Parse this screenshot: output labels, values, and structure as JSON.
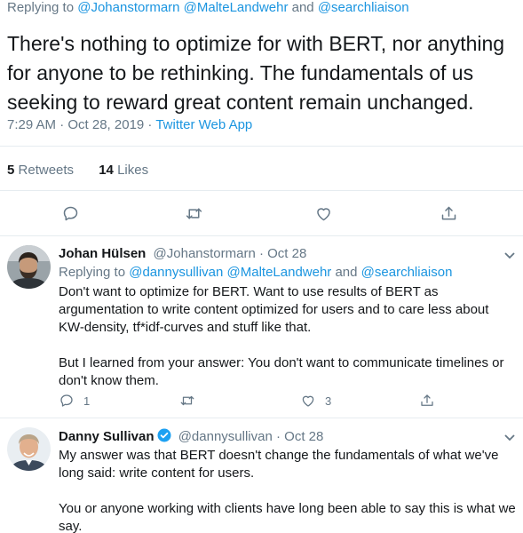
{
  "main_tweet": {
    "replying_prefix": "Replying to",
    "replying_handles": "@Johanstormarn @MalteLandwehr",
    "replying_and": "and",
    "replying_last": "@searchliaison",
    "text": "There's nothing to optimize for with BERT, nor anything for anyone to be rethinking. The fundamentals of us seeking to reward great content remain unchanged.",
    "time": "7:29 AM · Oct 28, 2019 ·",
    "source": "Twitter Web App",
    "retweets_count": "5",
    "retweets_label": "Retweets",
    "likes_count": "14",
    "likes_label": "Likes",
    "actions": {
      "reply_icon": "reply-icon",
      "retweet_icon": "retweet-icon",
      "like_icon": "heart-icon",
      "share_icon": "share-icon"
    }
  },
  "replies": [
    {
      "name": "Johan Hülsen",
      "handle": "@Johanstormarn · Oct 28",
      "replying_prefix": "Replying to",
      "replying_handles": "@dannysullivan @MalteLandwehr",
      "replying_and": "and",
      "replying_last": "@searchliaison",
      "paragraph_1": "Don't want to optimize for BERT. Want to use results of BERT as argumentation to write content optimized for users and to care less about KW-density, tf*idf-curves and stuff like that.",
      "paragraph_2": "But I learned from your answer: You don't want to communicate timelines or don't know them.",
      "reply_count": "1",
      "retweet_count": "",
      "like_count": "3"
    },
    {
      "name": "Danny Sullivan",
      "handle": "@dannysullivan · Oct 28",
      "paragraph_1": "My answer was that BERT doesn't change the fundamentals of what we've long said: write content for users.",
      "paragraph_2": "You or anyone working with clients have long been able to say this is what we say."
    }
  ],
  "colors": {
    "link": "#1b95e0",
    "muted": "#657786",
    "text": "#14171a",
    "divider": "#e6ecf0",
    "verified": "#1da1f2"
  }
}
